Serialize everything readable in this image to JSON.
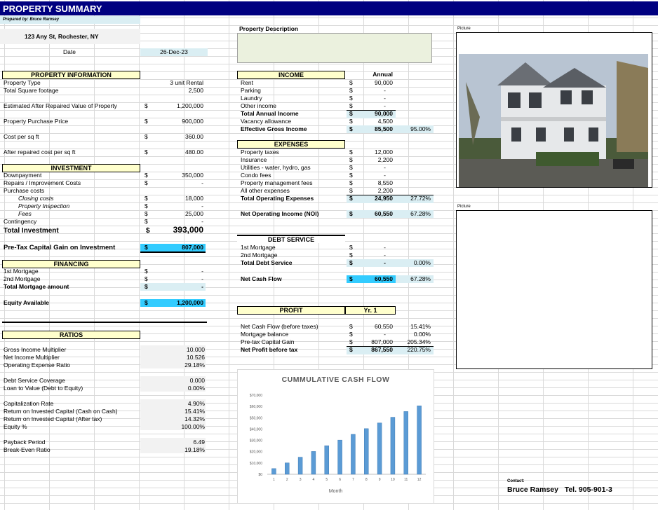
{
  "title": "PROPERTY SUMMARY",
  "prepared_by": "Prepared by: Bruce Ramsey",
  "address": "123 Any St, Rochester, NY",
  "date_label": "Date",
  "date_value": "26-Dec-23",
  "property_info": {
    "header": "PROPERTY INFORMATION",
    "type_label": "Property Type",
    "type_value": "3 unit Rental",
    "sqft_label": "Total Square footage",
    "sqft_value": "2,500",
    "arv_label": "Estimated After Repaired Value of Property",
    "arv_cur": "$",
    "arv_value": "1,200,000",
    "price_label": "Property Purchase Price",
    "price_cur": "$",
    "price_value": "900,000",
    "cost_sqft_label": "Cost per sq ft",
    "cost_sqft_cur": "$",
    "cost_sqft_value": "360.00",
    "arc_sqft_label": "After repaired cost per sq ft",
    "arc_sqft_cur": "$",
    "arc_sqft_value": "480.00"
  },
  "investment": {
    "header": "INVESTMENT",
    "downpayment_label": "Downpayment",
    "downpayment_cur": "$",
    "downpayment_value": "350,000",
    "repairs_label": "Repairs / Improvement Costs",
    "repairs_cur": "$",
    "repairs_value": "-",
    "purchase_label": "Purchase costs",
    "closing_label": "Closing costs",
    "closing_cur": "$",
    "closing_value": "18,000",
    "inspection_label": "Property Inspection",
    "inspection_cur": "$",
    "inspection_value": "-",
    "fees_label": "Fees",
    "fees_cur": "$",
    "fees_value": "25,000",
    "contingency_label": "Contingency",
    "contingency_cur": "$",
    "contingency_value": "-",
    "total_label": "Total Investment",
    "total_cur": "$",
    "total_value": "393,000",
    "pretax_label": "Pre-Tax Capital Gain on Investment",
    "pretax_cur": "$",
    "pretax_value": "807,000"
  },
  "financing": {
    "header": "FINANCING",
    "first_label": "1st Mortgage",
    "first_cur": "$",
    "first_value": "-",
    "second_label": "2nd Mortgage",
    "second_cur": "$",
    "second_value": "-",
    "total_label": "Total Mortgage amount",
    "total_cur": "$",
    "total_value": "-",
    "equity_label": "Equity Available",
    "equity_cur": "$",
    "equity_value": "1,200,000"
  },
  "ratios": {
    "header": "RATIOS",
    "gim_label": "Gross Income Multiplier",
    "gim_value": "10.000",
    "nim_label": "Net Income Multiplier",
    "nim_value": "10.526",
    "oer_label": "Operating Expense Ratio",
    "oer_value": "29.18%",
    "dsc_label": "Debt Service Coverage",
    "dsc_value": "0.000",
    "ltv_label": "Loan to Value (Debt to Equity)",
    "ltv_value": "0.00%",
    "cap_label": "Capitalization Rate",
    "cap_value": "4.90%",
    "roic_cash_label": "Return on Invested Capital (Cash on Cash)",
    "roic_cash_value": "15.41%",
    "roic_tax_label": "Return on Invested Capital (After tax)",
    "roic_tax_value": "14.32%",
    "equity_label": "Equity %",
    "equity_value": "100.00%",
    "payback_label": "Payback Period",
    "payback_value": "6.49",
    "breakeven_label": "Break-Even Ratio",
    "breakeven_value": "19.18%"
  },
  "property_description_label": "Property Description",
  "picture_label_1": "Picture",
  "picture_label_2": "Picture",
  "income": {
    "header": "INCOME",
    "annual_label": "Annual",
    "rent_label": "Rent",
    "rent_cur": "$",
    "rent_value": "90,000",
    "parking_label": "Parking",
    "parking_cur": "$",
    "parking_value": "-",
    "laundry_label": "Laundry",
    "laundry_cur": "$",
    "laundry_value": "-",
    "other_label": "Other income",
    "other_cur": "$",
    "other_value": "-",
    "total_label": "Total Annual Income",
    "total_cur": "$",
    "total_value": "90,000",
    "vacancy_label": "Vacancy allowance",
    "vacancy_cur": "$",
    "vacancy_value": "4,500",
    "egi_label": "Effective Gross Income",
    "egi_cur": "$",
    "egi_value": "85,500",
    "egi_pct": "95.00%"
  },
  "expenses": {
    "header": "EXPENSES",
    "tax_label": "Property taxes",
    "tax_cur": "$",
    "tax_value": "12,000",
    "ins_label": "Insurance",
    "ins_cur": "$",
    "ins_value": "2,200",
    "util_label": "Utilities - water, hydro, gas",
    "util_cur": "$",
    "util_value": "-",
    "condo_label": "Condo fees",
    "condo_cur": "$",
    "condo_value": "-",
    "mgmt_label": "Property management fees",
    "mgmt_cur": "$",
    "mgmt_value": "8,550",
    "other_label": "All other expenses",
    "other_cur": "$",
    "other_value": "2,200",
    "total_label": "Total Operating Expenses",
    "total_cur": "$",
    "total_value": "24,950",
    "total_pct": "27.72%",
    "noi_label": "Net Operating Income (NOI)",
    "noi_cur": "$",
    "noi_value": "60,550",
    "noi_pct": "67.28%"
  },
  "debt": {
    "header": "DEBT SERVICE",
    "first_label": "1st Mortgage",
    "first_cur": "$",
    "first_value": "-",
    "second_label": "2nd Mortgage",
    "second_cur": "$",
    "second_value": "-",
    "total_label": "Total Debt Service",
    "total_cur": "$",
    "total_value": "-",
    "total_pct": "0.00%",
    "ncf_label": "Net Cash Flow",
    "ncf_cur": "$",
    "ncf_value": "60,550",
    "ncf_pct": "67.28%"
  },
  "profit": {
    "header": "PROFIT",
    "year_label": "Yr. 1",
    "ncf_label": "Net Cash Flow (before taxes)",
    "ncf_cur": "$",
    "ncf_value": "60,550",
    "ncf_pct": "15.41%",
    "mort_label": "Mortgage balance",
    "mort_cur": "$",
    "mort_value": "-",
    "mort_pct": "0.00%",
    "cap_label": "Pre-tax Capital Gain",
    "cap_cur": "$",
    "cap_value": "807,000",
    "cap_pct": "205.34%",
    "net_label": "Net Profit before tax",
    "net_cur": "$",
    "net_value": "867,550",
    "net_pct": "220.75%"
  },
  "contact_label": "Contact:",
  "contact_value": "Bruce Ramsey   Tel. 905-901-3",
  "colors": {
    "title_bar": "#000080",
    "header_fill": "#ffffcc",
    "highlight": "#33ccff",
    "light": "#daeef3",
    "bar": "#5b9bd5"
  },
  "chart_data": {
    "type": "bar",
    "title": "CUMMULATIVE CASH FLOW",
    "xlabel": "Month",
    "ylabel": "",
    "categories": [
      "1",
      "2",
      "3",
      "4",
      "5",
      "6",
      "7",
      "8",
      "9",
      "10",
      "11",
      "12"
    ],
    "values": [
      5046,
      10092,
      15138,
      20183,
      25229,
      30275,
      35321,
      40367,
      45413,
      50458,
      55504,
      60550
    ],
    "ylim": [
      0,
      70000
    ],
    "yticks": [
      "$0",
      "$10,000",
      "$20,000",
      "$30,000",
      "$40,000",
      "$50,000",
      "$60,000",
      "$70,000"
    ],
    "grid": false
  }
}
